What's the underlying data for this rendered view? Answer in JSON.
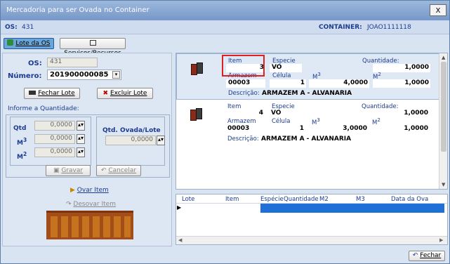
{
  "window": {
    "title": "Mercadoria para ser Ovada no Container",
    "close": "x"
  },
  "header": {
    "os_label": "OS:",
    "os_value": "431",
    "container_label": "CONTAINER:",
    "container_value": "JOAO1111118"
  },
  "tabs": [
    {
      "label": "Lote da OS"
    },
    {
      "label": "Serviços/Recursos"
    }
  ],
  "form": {
    "os_label": "OS:",
    "os_value": "431",
    "numero_label": "Número:",
    "numero_value": "201900000085",
    "fechar_lote": "Fechar Lote",
    "excluir_lote": "Excluir Lote",
    "informe": "Informe a Quantidade:",
    "qtd_label": "Qtd",
    "qtd_value": "0,0000",
    "m3_label": "M",
    "m2_label": "M",
    "m3_value": "0,0000",
    "m2_value": "0,0000",
    "qtd_ovada_label": "Qtd. Ovada/Lote",
    "qtd_ovada_value": "0,0000",
    "gravar": "Gravar",
    "cancelar": "Cancelar",
    "ovar_item": "Ovar Item",
    "desovar_item": "Desovar Item"
  },
  "cards": [
    {
      "item_label": "Item",
      "item": "3",
      "especie_label": "Especie",
      "especie": "VO",
      "quantidade_label": "Quantidade:",
      "quantidade": "1,0000",
      "armazem_label": "Armazem",
      "armazem": "00003",
      "celula_label": "Célula",
      "celula": "1",
      "m3_label": "M",
      "m3": "4,0000",
      "m2_label": "M",
      "m2": "1,0000",
      "descricao_label": "Descrição:",
      "descricao": "ARMAZEM A - ALVANARIA"
    },
    {
      "item_label": "Item",
      "item": "4",
      "especie_label": "Especie",
      "especie": "VO",
      "quantidade_label": "Quantidade:",
      "quantidade": "1,0000",
      "armazem_label": "Armazem",
      "armazem": "00003",
      "celula_label": "Célula",
      "celula": "1",
      "m3_label": "M",
      "m3": "3,0000",
      "m2_label": "M",
      "m2": "1,0000",
      "descricao_label": "Descrição:",
      "descricao": "ARMAZEM A - ALVANARIA"
    }
  ],
  "grid": {
    "columns": [
      "Lote",
      "Item",
      "Espécie",
      "Quantidade",
      "M2",
      "M3",
      "Data da Ova"
    ]
  },
  "footer": {
    "fechar": "Fechar"
  }
}
